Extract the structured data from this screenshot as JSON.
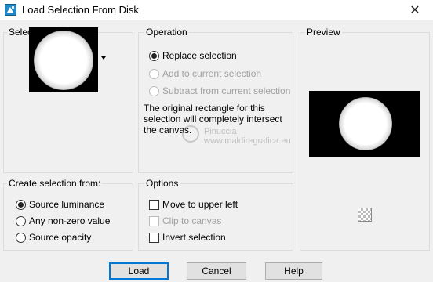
{
  "window": {
    "title": "Load Selection From Disk",
    "close_glyph": "✕"
  },
  "selection_group": {
    "title": "Selection"
  },
  "operation_group": {
    "title": "Operation",
    "options": [
      {
        "label": "Replace selection",
        "checked": true,
        "enabled": true
      },
      {
        "label": "Add to current selection",
        "checked": false,
        "enabled": false
      },
      {
        "label": "Subtract from current selection",
        "checked": false,
        "enabled": false
      }
    ],
    "info_text": "The original rectangle for this selection will completely intersect the canvas."
  },
  "preview_group": {
    "title": "Preview"
  },
  "create_group": {
    "title": "Create selection from:",
    "options": [
      {
        "label": "Source luminance",
        "checked": true
      },
      {
        "label": "Any non-zero value",
        "checked": false
      },
      {
        "label": "Source opacity",
        "checked": false
      }
    ]
  },
  "options_group": {
    "title": "Options",
    "checks": [
      {
        "label": "Move to upper left",
        "checked": false,
        "enabled": true
      },
      {
        "label": "Clip to canvas",
        "checked": false,
        "enabled": false
      },
      {
        "label": "Invert selection",
        "checked": false,
        "enabled": true
      }
    ]
  },
  "buttons": {
    "load": "Load",
    "cancel": "Cancel",
    "help": "Help"
  },
  "watermark": {
    "name": "Pinuccia",
    "site": "www.maldiregrafica.eu"
  },
  "icons": {
    "app": "app-icon",
    "checker": "transparency-checker-icon"
  },
  "colors": {
    "accent": "#0078d7",
    "dialog_bg": "#f0f0f0"
  }
}
